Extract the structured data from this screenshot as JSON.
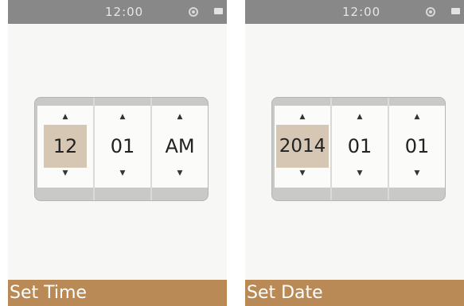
{
  "screens": [
    {
      "status_bar": {
        "time": "12:00",
        "icons": [
          "wifi-icon",
          "battery-icon"
        ]
      },
      "picker": {
        "columns": [
          {
            "value": "12",
            "selected": true,
            "arrows": [
              "▲",
              "▼"
            ]
          },
          {
            "value": "01",
            "selected": false,
            "arrows": [
              "▲",
              "▼"
            ]
          },
          {
            "value": "AM",
            "selected": false,
            "arrows": [
              "▲",
              "▼"
            ]
          }
        ]
      },
      "title": "Set Time"
    },
    {
      "status_bar": {
        "time": "12:00",
        "icons": [
          "wifi-icon",
          "battery-icon"
        ]
      },
      "picker": {
        "columns": [
          {
            "value": "2014",
            "selected": true,
            "arrows": [
              "▲",
              "▼"
            ]
          },
          {
            "value": "01",
            "selected": false,
            "arrows": [
              "▲",
              "▼"
            ]
          },
          {
            "value": "01",
            "selected": false,
            "arrows": [
              "▲",
              "▼"
            ]
          }
        ]
      },
      "title": "Set Date"
    }
  ],
  "colors": {
    "status_bar": "#888888",
    "title_bar": "#b98a56",
    "selection": "#d6c7b4",
    "picker_frame": "#c9c9c7",
    "screen_bg": "#f7f7f5"
  }
}
